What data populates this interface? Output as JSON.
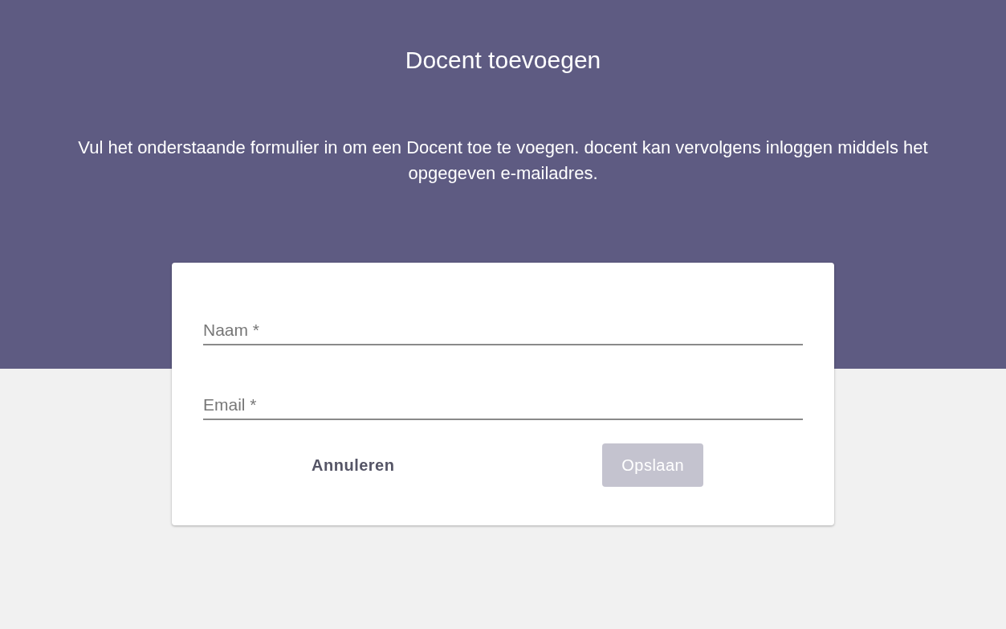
{
  "header": {
    "title": "Docent toevoegen",
    "description": "Vul het onderstaande formulier in om een Docent toe te voegen. docent kan vervolgens inloggen middels het opgegeven e-mailadres."
  },
  "form": {
    "fields": [
      {
        "placeholder": "Naam *"
      },
      {
        "placeholder": "Email *"
      }
    ],
    "buttons": [
      {
        "label": "Annuleren",
        "kind": "text",
        "disabled": false
      },
      {
        "label": "Opslaan",
        "kind": "filled",
        "disabled": true
      }
    ]
  }
}
